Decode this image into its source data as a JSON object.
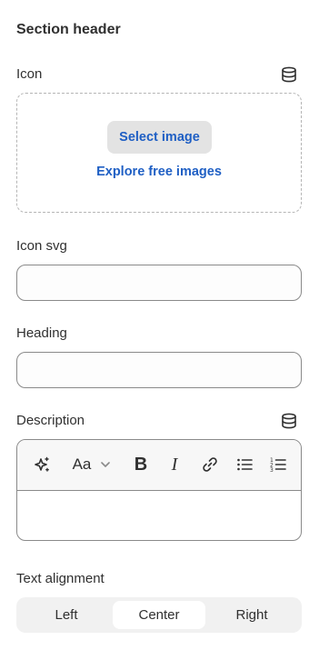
{
  "section": {
    "title": "Section header"
  },
  "icon_field": {
    "label": "Icon",
    "select_image_label": "Select image",
    "explore_label": "Explore free images"
  },
  "icon_svg_field": {
    "label": "Icon svg",
    "value": ""
  },
  "heading_field": {
    "label": "Heading",
    "value": ""
  },
  "description_field": {
    "label": "Description",
    "toolbar": {
      "magic": "sparkle-icon",
      "font_size": "Aa",
      "bold": "B",
      "italic": "I",
      "link": "link-icon",
      "bulleted_list": "bullet-list-icon",
      "numbered_list": "numbered-list-icon"
    }
  },
  "text_alignment": {
    "label": "Text alignment",
    "options": [
      "Left",
      "Center",
      "Right"
    ],
    "selected": "Center"
  },
  "colors": {
    "link_blue": "#1f5fc4",
    "text": "#303030",
    "border": "#8a8a8a"
  }
}
